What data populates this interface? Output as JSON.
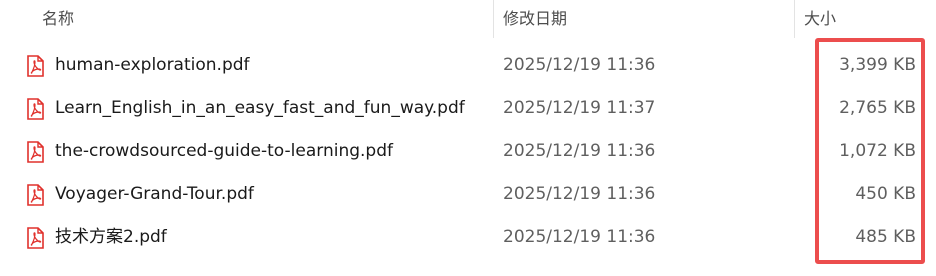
{
  "columns": {
    "name": "名称",
    "modified": "修改日期",
    "size": "大小"
  },
  "files": [
    {
      "icon": "pdf-icon",
      "name": "human-exploration.pdf",
      "modified": "2025/12/19 11:36",
      "size": "3,399 KB"
    },
    {
      "icon": "pdf-icon",
      "name": "Learn_English_in_an_easy_fast_and_fun_way.pdf",
      "modified": "2025/12/19 11:37",
      "size": "2,765 KB"
    },
    {
      "icon": "pdf-icon",
      "name": "the-crowdsourced-guide-to-learning.pdf",
      "modified": "2025/12/19 11:36",
      "size": "1,072 KB"
    },
    {
      "icon": "pdf-icon",
      "name": "Voyager-Grand-Tour.pdf",
      "modified": "2025/12/19 11:36",
      "size": "450 KB"
    },
    {
      "icon": "pdf-icon",
      "name": "技术方案2.pdf",
      "modified": "2025/12/19 11:36",
      "size": "485 KB"
    }
  ],
  "colors": {
    "pdf_icon": "#e0312c",
    "highlight": "#ec4d4d"
  }
}
